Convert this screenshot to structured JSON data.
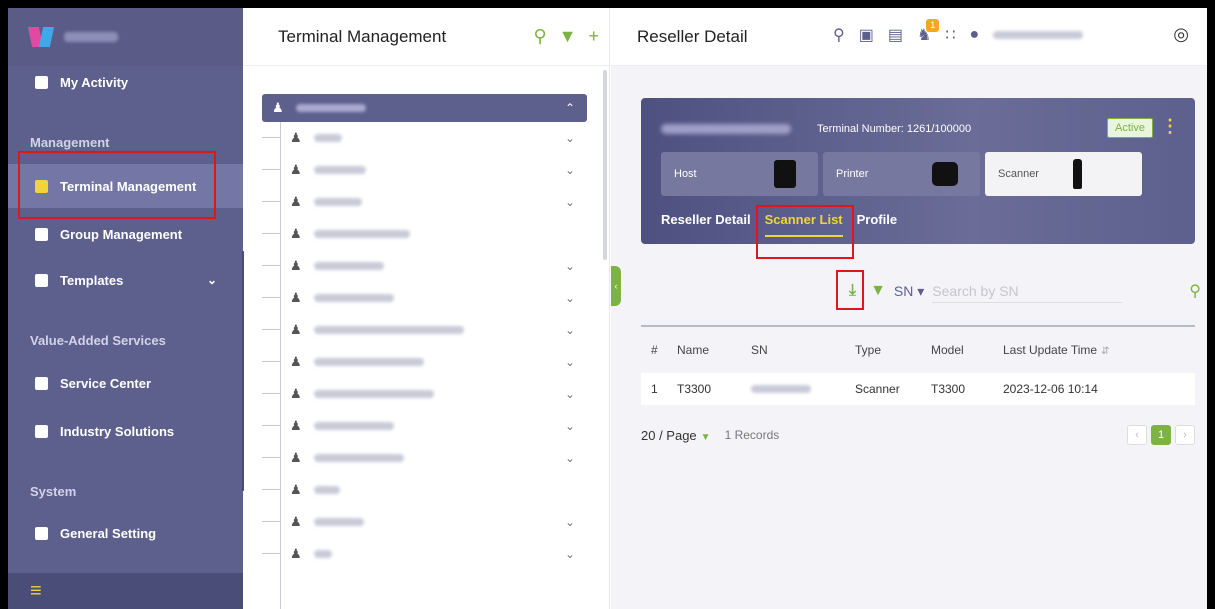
{
  "sidebar": {
    "items": [
      {
        "label": "My Activity",
        "icon": "clipboard-icon"
      },
      {
        "label": "Terminal Management",
        "icon": "terminal-icon"
      },
      {
        "label": "Group Management",
        "icon": "group-icon"
      },
      {
        "label": "Templates",
        "icon": "template-icon"
      },
      {
        "label": "Service Center",
        "icon": "service-icon"
      },
      {
        "label": "Industry Solutions",
        "icon": "solutions-icon"
      },
      {
        "label": "General Setting",
        "icon": "settings-icon"
      }
    ],
    "sections": {
      "management": "Management",
      "value_added": "Value-Added Services",
      "system": "System"
    }
  },
  "middle": {
    "title": "Terminal Management",
    "tree_chevrons": [
      "⌄"
    ]
  },
  "right": {
    "title": "Reseller Detail",
    "notification_count": "1",
    "card": {
      "terminal_number": "Terminal Number: 1261/100000",
      "status": "Active",
      "devices": [
        "Host",
        "Printer",
        "Scanner"
      ],
      "tabs": [
        "Reseller Detail",
        "Scanner List",
        "Profile"
      ]
    },
    "filter": {
      "field": "SN",
      "placeholder": "Search by SN"
    },
    "table": {
      "headers": [
        "#",
        "Name",
        "SN",
        "Type",
        "Model",
        "Last Update Time"
      ],
      "rows": [
        {
          "num": "1",
          "name": "T3300",
          "type": "Scanner",
          "model": "T3300",
          "time": "2023-12-06 10:14"
        }
      ]
    },
    "pager": {
      "page_size": "20 / Page",
      "records": "1 Records",
      "current_page": "1"
    }
  },
  "colors": {
    "brand": "#5d5f8d",
    "accent": "#7cb342",
    "highlight": "#f1d43a",
    "annotation": "#e0161b"
  }
}
